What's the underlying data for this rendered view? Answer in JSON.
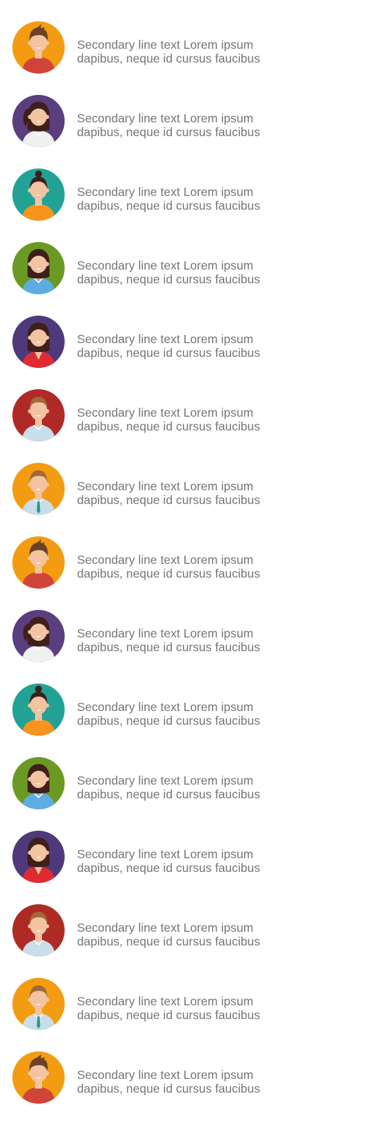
{
  "list": {
    "items": [
      {
        "line1": "Secondary line text Lorem ipsum",
        "line2": "dapibus, neque id cursus faucibus",
        "avatar": {
          "icon": "man-spiky-hair-avatar-icon",
          "bg": "#F39C12",
          "skin": "#F2C4A2",
          "hair": "#6B4226",
          "shirt": "#D0453A",
          "style": "spiky"
        }
      },
      {
        "line1": "Secondary line text Lorem ipsum",
        "line2": "dapibus, neque id cursus faucibus",
        "avatar": {
          "icon": "woman-ponytail-avatar-icon",
          "bg": "#5A3E7E",
          "skin": "#F2C4A2",
          "hair": "#3E1F1B",
          "shirt": "#F0F0F0",
          "style": "ponytail"
        }
      },
      {
        "line1": "Secondary line text Lorem ipsum",
        "line2": "dapibus, neque id cursus faucibus",
        "avatar": {
          "icon": "woman-bun-avatar-icon",
          "bg": "#22A295",
          "skin": "#F2C4A2",
          "hair": "#3E1F1B",
          "shirt": "#F7941D",
          "style": "bun"
        }
      },
      {
        "line1": "Secondary line text Lorem ipsum",
        "line2": "dapibus, neque id cursus faucibus",
        "avatar": {
          "icon": "woman-collar-avatar-icon",
          "bg": "#6A9A23",
          "skin": "#F2C4A2",
          "hair": "#3E1F1B",
          "shirt": "#5DADE2",
          "style": "bob"
        }
      },
      {
        "line1": "Secondary line text Lorem ipsum",
        "line2": "dapibus, neque id cursus faucibus",
        "avatar": {
          "icon": "woman-long-hair-avatar-icon",
          "bg": "#4E3A7A",
          "skin": "#F2C4A2",
          "hair": "#3E1F1B",
          "shirt": "#E02B35",
          "style": "long"
        }
      },
      {
        "line1": "Secondary line text Lorem ipsum",
        "line2": "dapibus, neque id cursus faucibus",
        "avatar": {
          "icon": "man-shirt-avatar-icon",
          "bg": "#B02A25",
          "skin": "#F2C4A2",
          "hair": "#A0693A",
          "shirt": "#C9DDEA",
          "style": "short"
        }
      },
      {
        "line1": "Secondary line text Lorem ipsum",
        "line2": "dapibus, neque id cursus faucibus",
        "avatar": {
          "icon": "man-tie-avatar-icon",
          "bg": "#F39C12",
          "skin": "#F2C4A2",
          "hair": "#A0693A",
          "shirt": "#C9DDEA",
          "style": "tie"
        }
      },
      {
        "line1": "Secondary line text Lorem ipsum",
        "line2": "dapibus, neque id cursus faucibus",
        "avatar": {
          "icon": "man-spiky-hair-avatar-icon",
          "bg": "#F39C12",
          "skin": "#F2C4A2",
          "hair": "#6B4226",
          "shirt": "#D0453A",
          "style": "spiky"
        }
      },
      {
        "line1": "Secondary line text Lorem ipsum",
        "line2": "dapibus, neque id cursus faucibus",
        "avatar": {
          "icon": "woman-ponytail-avatar-icon",
          "bg": "#5A3E7E",
          "skin": "#F2C4A2",
          "hair": "#3E1F1B",
          "shirt": "#F0F0F0",
          "style": "ponytail"
        }
      },
      {
        "line1": "Secondary line text Lorem ipsum",
        "line2": "dapibus, neque id cursus faucibus",
        "avatar": {
          "icon": "woman-bun-avatar-icon",
          "bg": "#22A295",
          "skin": "#F2C4A2",
          "hair": "#3E1F1B",
          "shirt": "#F7941D",
          "style": "bun"
        }
      },
      {
        "line1": "Secondary line text Lorem ipsum",
        "line2": "dapibus, neque id cursus faucibus",
        "avatar": {
          "icon": "woman-collar-avatar-icon",
          "bg": "#6A9A23",
          "skin": "#F2C4A2",
          "hair": "#3E1F1B",
          "shirt": "#5DADE2",
          "style": "bob"
        }
      },
      {
        "line1": "Secondary line text Lorem ipsum",
        "line2": "dapibus, neque id cursus faucibus",
        "avatar": {
          "icon": "woman-long-hair-avatar-icon",
          "bg": "#4E3A7A",
          "skin": "#F2C4A2",
          "hair": "#3E1F1B",
          "shirt": "#E02B35",
          "style": "long"
        }
      },
      {
        "line1": "Secondary line text Lorem ipsum",
        "line2": "dapibus, neque id cursus faucibus",
        "avatar": {
          "icon": "man-shirt-avatar-icon",
          "bg": "#B02A25",
          "skin": "#F2C4A2",
          "hair": "#A0693A",
          "shirt": "#C9DDEA",
          "style": "short"
        }
      },
      {
        "line1": "Secondary line text Lorem ipsum",
        "line2": "dapibus, neque id cursus faucibus",
        "avatar": {
          "icon": "man-tie-avatar-icon",
          "bg": "#F39C12",
          "skin": "#F2C4A2",
          "hair": "#A0693A",
          "shirt": "#C9DDEA",
          "style": "tie"
        }
      },
      {
        "line1": "Secondary line text Lorem ipsum",
        "line2": "dapibus, neque id cursus faucibus",
        "avatar": {
          "icon": "man-spiky-hair-avatar-icon",
          "bg": "#F39C12",
          "skin": "#F2C4A2",
          "hair": "#6B4226",
          "shirt": "#D0453A",
          "style": "spiky"
        }
      }
    ]
  }
}
